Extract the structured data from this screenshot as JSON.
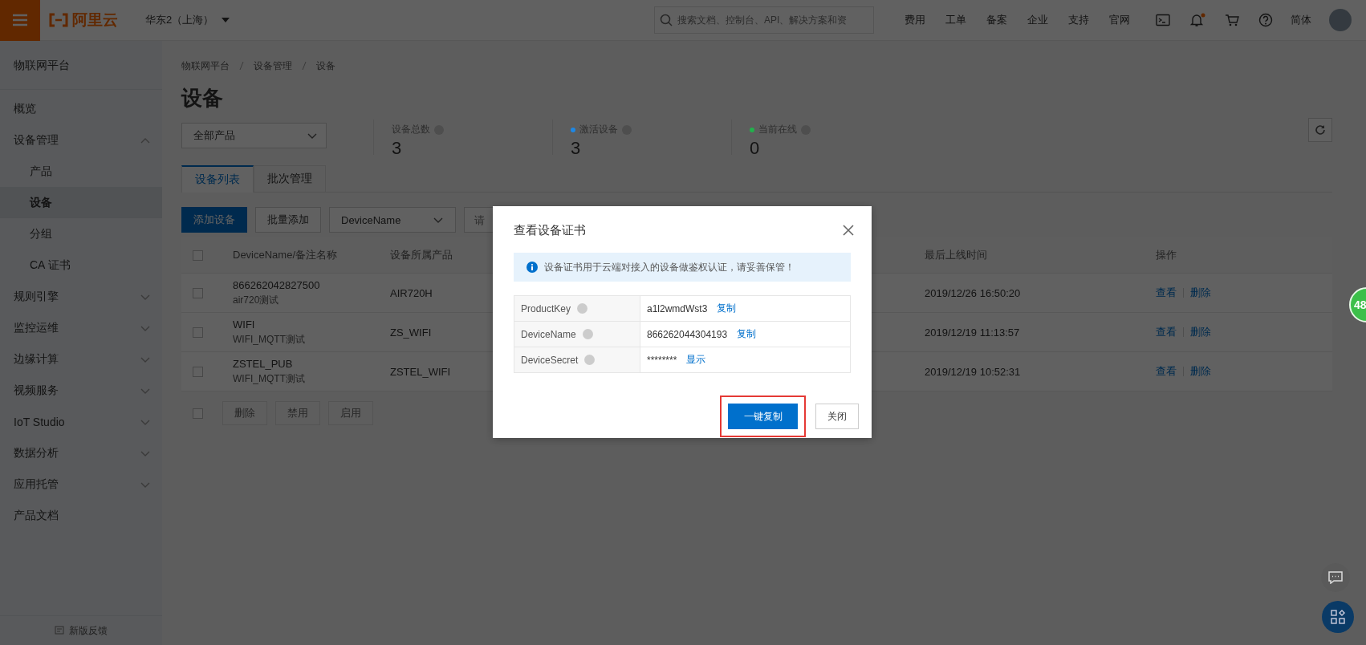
{
  "topbar": {
    "brand": "阿里云",
    "region": "华东2（上海）",
    "search": {
      "placeholder": "搜索文档、控制台、API、解决方案和资"
    },
    "links": [
      "费用",
      "工单",
      "备案",
      "企业",
      "支持",
      "官网"
    ],
    "unread_notifications": true,
    "language": "简体"
  },
  "sidebar": {
    "title": "物联网平台",
    "items": [
      {
        "kind": "link",
        "label": "概览",
        "selected": false
      },
      {
        "kind": "group",
        "label": "设备管理",
        "expanded": true,
        "children": [
          {
            "label": "产品",
            "selected": false
          },
          {
            "label": "设备",
            "selected": true
          },
          {
            "label": "分组",
            "selected": false
          },
          {
            "label": "CA 证书",
            "selected": false
          }
        ]
      },
      {
        "kind": "group",
        "label": "规则引擎",
        "expanded": false
      },
      {
        "kind": "group",
        "label": "监控运维",
        "expanded": false
      },
      {
        "kind": "group",
        "label": "边缘计算",
        "expanded": false
      },
      {
        "kind": "group",
        "label": "视频服务",
        "expanded": false
      },
      {
        "kind": "group",
        "label": "IoT Studio",
        "expanded": false
      },
      {
        "kind": "group",
        "label": "数据分析",
        "expanded": false
      },
      {
        "kind": "group",
        "label": "应用托管",
        "expanded": false
      },
      {
        "kind": "link",
        "label": "产品文档",
        "selected": false
      }
    ],
    "feedback": "新版反馈"
  },
  "page": {
    "breadcrumb": [
      "物联网平台",
      "设备管理",
      "设备"
    ],
    "title": "设备",
    "product_filter": "全部产品",
    "stats": [
      {
        "label": "设备总数",
        "value": "3"
      },
      {
        "label": "激活设备",
        "value": "3",
        "color": "#1e88e5"
      },
      {
        "label": "当前在线",
        "value": "0",
        "color": "#22b14c"
      }
    ],
    "tabs": [
      {
        "label": "设备列表",
        "selected": true
      },
      {
        "label": "批次管理",
        "selected": false
      }
    ],
    "toolbar": {
      "primary": "添加设备",
      "secondary": "批量添加",
      "search_by": "DeviceName",
      "search": {
        "placeholder": "请"
      }
    },
    "table": {
      "all_checked": false,
      "columns": [
        "DeviceName/备注名称",
        "设备所属产品",
        "最后上线时间",
        "操作"
      ],
      "rows": [
        {
          "checked": false,
          "device_name": "866262042827500",
          "note": "air720测试",
          "product": "AIR720H",
          "last_online": "2019/12/26 16:50:20",
          "actions": [
            "查看",
            "删除"
          ]
        },
        {
          "checked": false,
          "device_name": "WIFI",
          "note": "WIFI_MQTT测试",
          "product": "ZS_WIFI",
          "last_online": "2019/12/19 11:13:57",
          "actions": [
            "查看",
            "删除"
          ]
        },
        {
          "checked": false,
          "device_name": "ZSTEL_PUB",
          "note": "WIFI_MQTT测试",
          "product": "ZSTEL_WIFI",
          "last_online": "2019/12/19 10:52:31",
          "actions": [
            "查看",
            "删除"
          ]
        }
      ]
    },
    "bulk_actions": {
      "checked": false,
      "buttons": [
        {
          "label": "删除",
          "disabled": true
        },
        {
          "label": "禁用",
          "disabled": true
        },
        {
          "label": "启用",
          "disabled": true
        }
      ]
    }
  },
  "dialog": {
    "title": "查看设备证书",
    "notice": "设备证书用于云端对接入的设备做鉴权认证，请妥善保管！",
    "fields": [
      {
        "label": "ProductKey",
        "value": "a1l2wmdWst3",
        "action": "复制"
      },
      {
        "label": "DeviceName",
        "value": "866262044304193",
        "action": "复制"
      },
      {
        "label": "DeviceSecret",
        "value": "********",
        "action": "显示"
      }
    ],
    "buttons": [
      {
        "label": "一键复制",
        "kind": "primary",
        "highlighted": true
      },
      {
        "label": "关闭",
        "kind": "default",
        "highlighted": false
      }
    ]
  },
  "floating": {
    "badge": "48"
  }
}
